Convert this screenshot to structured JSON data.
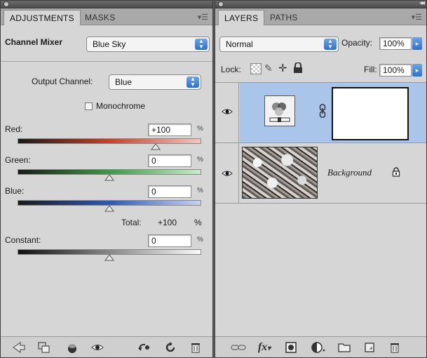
{
  "adjustments": {
    "tabs": [
      {
        "label": "ADJUSTMENTS"
      },
      {
        "label": "MASKS"
      }
    ],
    "preset_label": "Channel Mixer",
    "preset_value": "Blue Sky",
    "output_channel_label": "Output Channel:",
    "output_channel_value": "Blue",
    "monochrome_label": "Monochrome",
    "monochrome_checked": false,
    "sliders": [
      {
        "label": "Red:",
        "value": "+100",
        "unit": "%",
        "level": 100,
        "colors": [
          "#1a1a1a",
          "#c8402a",
          "#f3c6c0"
        ]
      },
      {
        "label": "Green:",
        "value": "0",
        "unit": "%",
        "level": 0,
        "colors": [
          "#1a1a1a",
          "#3c9a45",
          "#c9ecc8"
        ]
      },
      {
        "label": "Blue:",
        "value": "0",
        "unit": "%",
        "level": 0,
        "colors": [
          "#1a1a1a",
          "#2f58b8",
          "#c7d4f2"
        ]
      }
    ],
    "total_label": "Total:",
    "total_value": "+100",
    "total_unit": "%",
    "constant": {
      "label": "Constant:",
      "value": "0",
      "unit": "%",
      "level": 0,
      "colors": [
        "#111111",
        "#888888",
        "#fafafa"
      ]
    },
    "bottom_icons": [
      "back-arrow-icon",
      "clip-to-layer-icon",
      "visibility-toggle-icon",
      "view-previous-state-icon",
      "reset-icon",
      "reset-default-icon",
      "trash-icon"
    ]
  },
  "layers": {
    "tabs": [
      {
        "label": "LAYERS"
      },
      {
        "label": "PATHS"
      }
    ],
    "blend_mode": "Normal",
    "opacity_label": "Opacity:",
    "opacity_value": "100%",
    "lock_label": "Lock:",
    "fill_label": "Fill:",
    "fill_value": "100%",
    "rows": [
      {
        "name": "",
        "type": "adjustment",
        "selected": true
      },
      {
        "name": "Background",
        "type": "image",
        "selected": false,
        "locked": true
      }
    ],
    "bottom_icons": [
      "link-layers-icon",
      "fx-icon",
      "add-mask-icon",
      "new-adjustment-icon",
      "new-group-icon",
      "new-layer-icon",
      "trash-icon"
    ],
    "fx_text": "fx"
  },
  "colors": {
    "panel_bg": "#d6d6d6",
    "selection": "#a9c6ea",
    "popup_arrow": "#3b7bd6"
  }
}
